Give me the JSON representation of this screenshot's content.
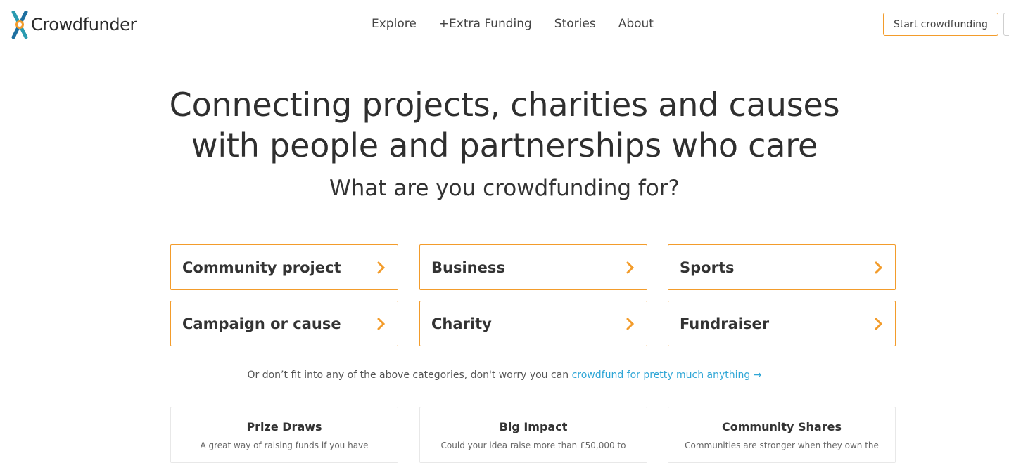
{
  "brand": {
    "name": "Crowdfunder",
    "accent": "#f39c2b",
    "link_color": "#2fa6d6",
    "logo_colors": [
      "#2a9bb0",
      "#1d6fa0",
      "#f39c2b"
    ]
  },
  "nav": {
    "items": [
      "Explore",
      "+Extra Funding",
      "Stories",
      "About"
    ],
    "start_button": "Start crowdfunding"
  },
  "hero": {
    "title_line1": "Connecting projects, charities and causes",
    "title_line2": "with people and partnerships who care",
    "subtitle": "What are you crowdfunding for?"
  },
  "categories": [
    {
      "label": "Community project",
      "icon": "chevron-right-icon"
    },
    {
      "label": "Business",
      "icon": "chevron-right-icon"
    },
    {
      "label": "Sports",
      "icon": "chevron-right-icon"
    },
    {
      "label": "Campaign or cause",
      "icon": "chevron-right-icon"
    },
    {
      "label": "Charity",
      "icon": "chevron-right-icon"
    },
    {
      "label": "Fundraiser",
      "icon": "chevron-right-icon"
    }
  ],
  "note": {
    "text": "Or don’t fit into any of the above categories, don't worry you can ",
    "link": "crowdfund for pretty much anything →"
  },
  "cards": [
    {
      "title": "Prize Draws",
      "text": "A great way of raising funds if you have"
    },
    {
      "title": "Big Impact",
      "text": "Could your idea raise more than £50,000 to"
    },
    {
      "title": "Community Shares",
      "text": "Communities are stronger when they own the"
    }
  ]
}
